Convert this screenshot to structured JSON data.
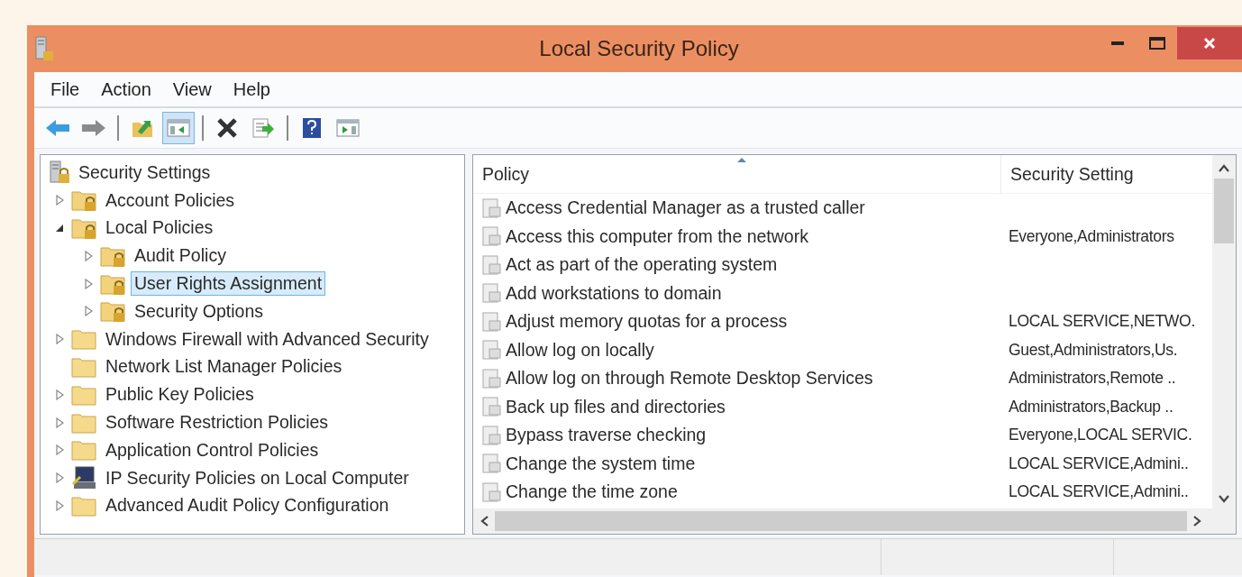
{
  "window": {
    "title": "Local Security Policy"
  },
  "menu": [
    "File",
    "Action",
    "View",
    "Help"
  ],
  "toolbar": [
    [
      {
        "kind": "back",
        "pressed": false
      },
      {
        "kind": "forward",
        "pressed": false
      }
    ],
    [
      {
        "kind": "up",
        "pressed": false
      },
      {
        "kind": "tree",
        "pressed": true
      }
    ],
    [
      {
        "kind": "delete",
        "pressed": false
      },
      {
        "kind": "export",
        "pressed": false
      }
    ],
    [
      {
        "kind": "help",
        "pressed": false
      },
      {
        "kind": "pane",
        "pressed": false
      }
    ]
  ],
  "tree": [
    {
      "label": "Security Settings",
      "kind": "root",
      "selected": false,
      "children": [
        {
          "label": "Account Policies",
          "kind": "locked-folder",
          "expanded": false,
          "selected": false
        },
        {
          "label": "Local Policies",
          "kind": "locked-folder",
          "expanded": true,
          "selected": false,
          "children": [
            {
              "label": "Audit Policy",
              "kind": "locked-folder",
              "expanded": false,
              "selected": false
            },
            {
              "label": "User Rights Assignment",
              "kind": "locked-folder",
              "expanded": false,
              "selected": true
            },
            {
              "label": "Security Options",
              "kind": "locked-folder",
              "expanded": false,
              "selected": false
            }
          ]
        },
        {
          "label": "Windows Firewall with Advanced Security",
          "kind": "folder",
          "expanded": false,
          "selected": false
        },
        {
          "label": "Network List Manager Policies",
          "kind": "folder",
          "selected": false
        },
        {
          "label": "Public Key Policies",
          "kind": "folder",
          "expanded": false,
          "selected": false
        },
        {
          "label": "Software Restriction Policies",
          "kind": "folder",
          "expanded": false,
          "selected": false
        },
        {
          "label": "Application Control Policies",
          "kind": "folder",
          "expanded": false,
          "selected": false
        },
        {
          "label": "IP Security Policies on Local Computer",
          "kind": "computer",
          "expanded": false,
          "selected": false
        },
        {
          "label": "Advanced Audit Policy Configuration",
          "kind": "folder",
          "expanded": false,
          "selected": false
        }
      ]
    }
  ],
  "table": {
    "columns": [
      "Policy",
      "Security Setting"
    ],
    "rows": [
      {
        "policy": "Access Credential Manager as a trusted caller"
      },
      {
        "policy": "Access this computer from the network",
        "setting": "Everyone,Administrators"
      },
      {
        "policy": "Act as part of the operating system"
      },
      {
        "policy": "Add workstations to domain"
      },
      {
        "policy": "Adjust memory quotas for a process",
        "setting": "LOCAL SERVICE,NETWO."
      },
      {
        "policy": "Allow log on locally",
        "setting": "Guest,Administrators,Us."
      },
      {
        "policy": "Allow log on through Remote Desktop Services",
        "setting": "Administrators,Remote .."
      },
      {
        "policy": "Back up files and directories",
        "setting": "Administrators,Backup .."
      },
      {
        "policy": "Bypass traverse checking",
        "setting": "Everyone,LOCAL SERVIC."
      },
      {
        "policy": "Change the system time",
        "setting": "LOCAL SERVICE,Admini.."
      },
      {
        "policy": "Change the time zone",
        "setting": "LOCAL SERVICE,Admini.."
      }
    ]
  }
}
